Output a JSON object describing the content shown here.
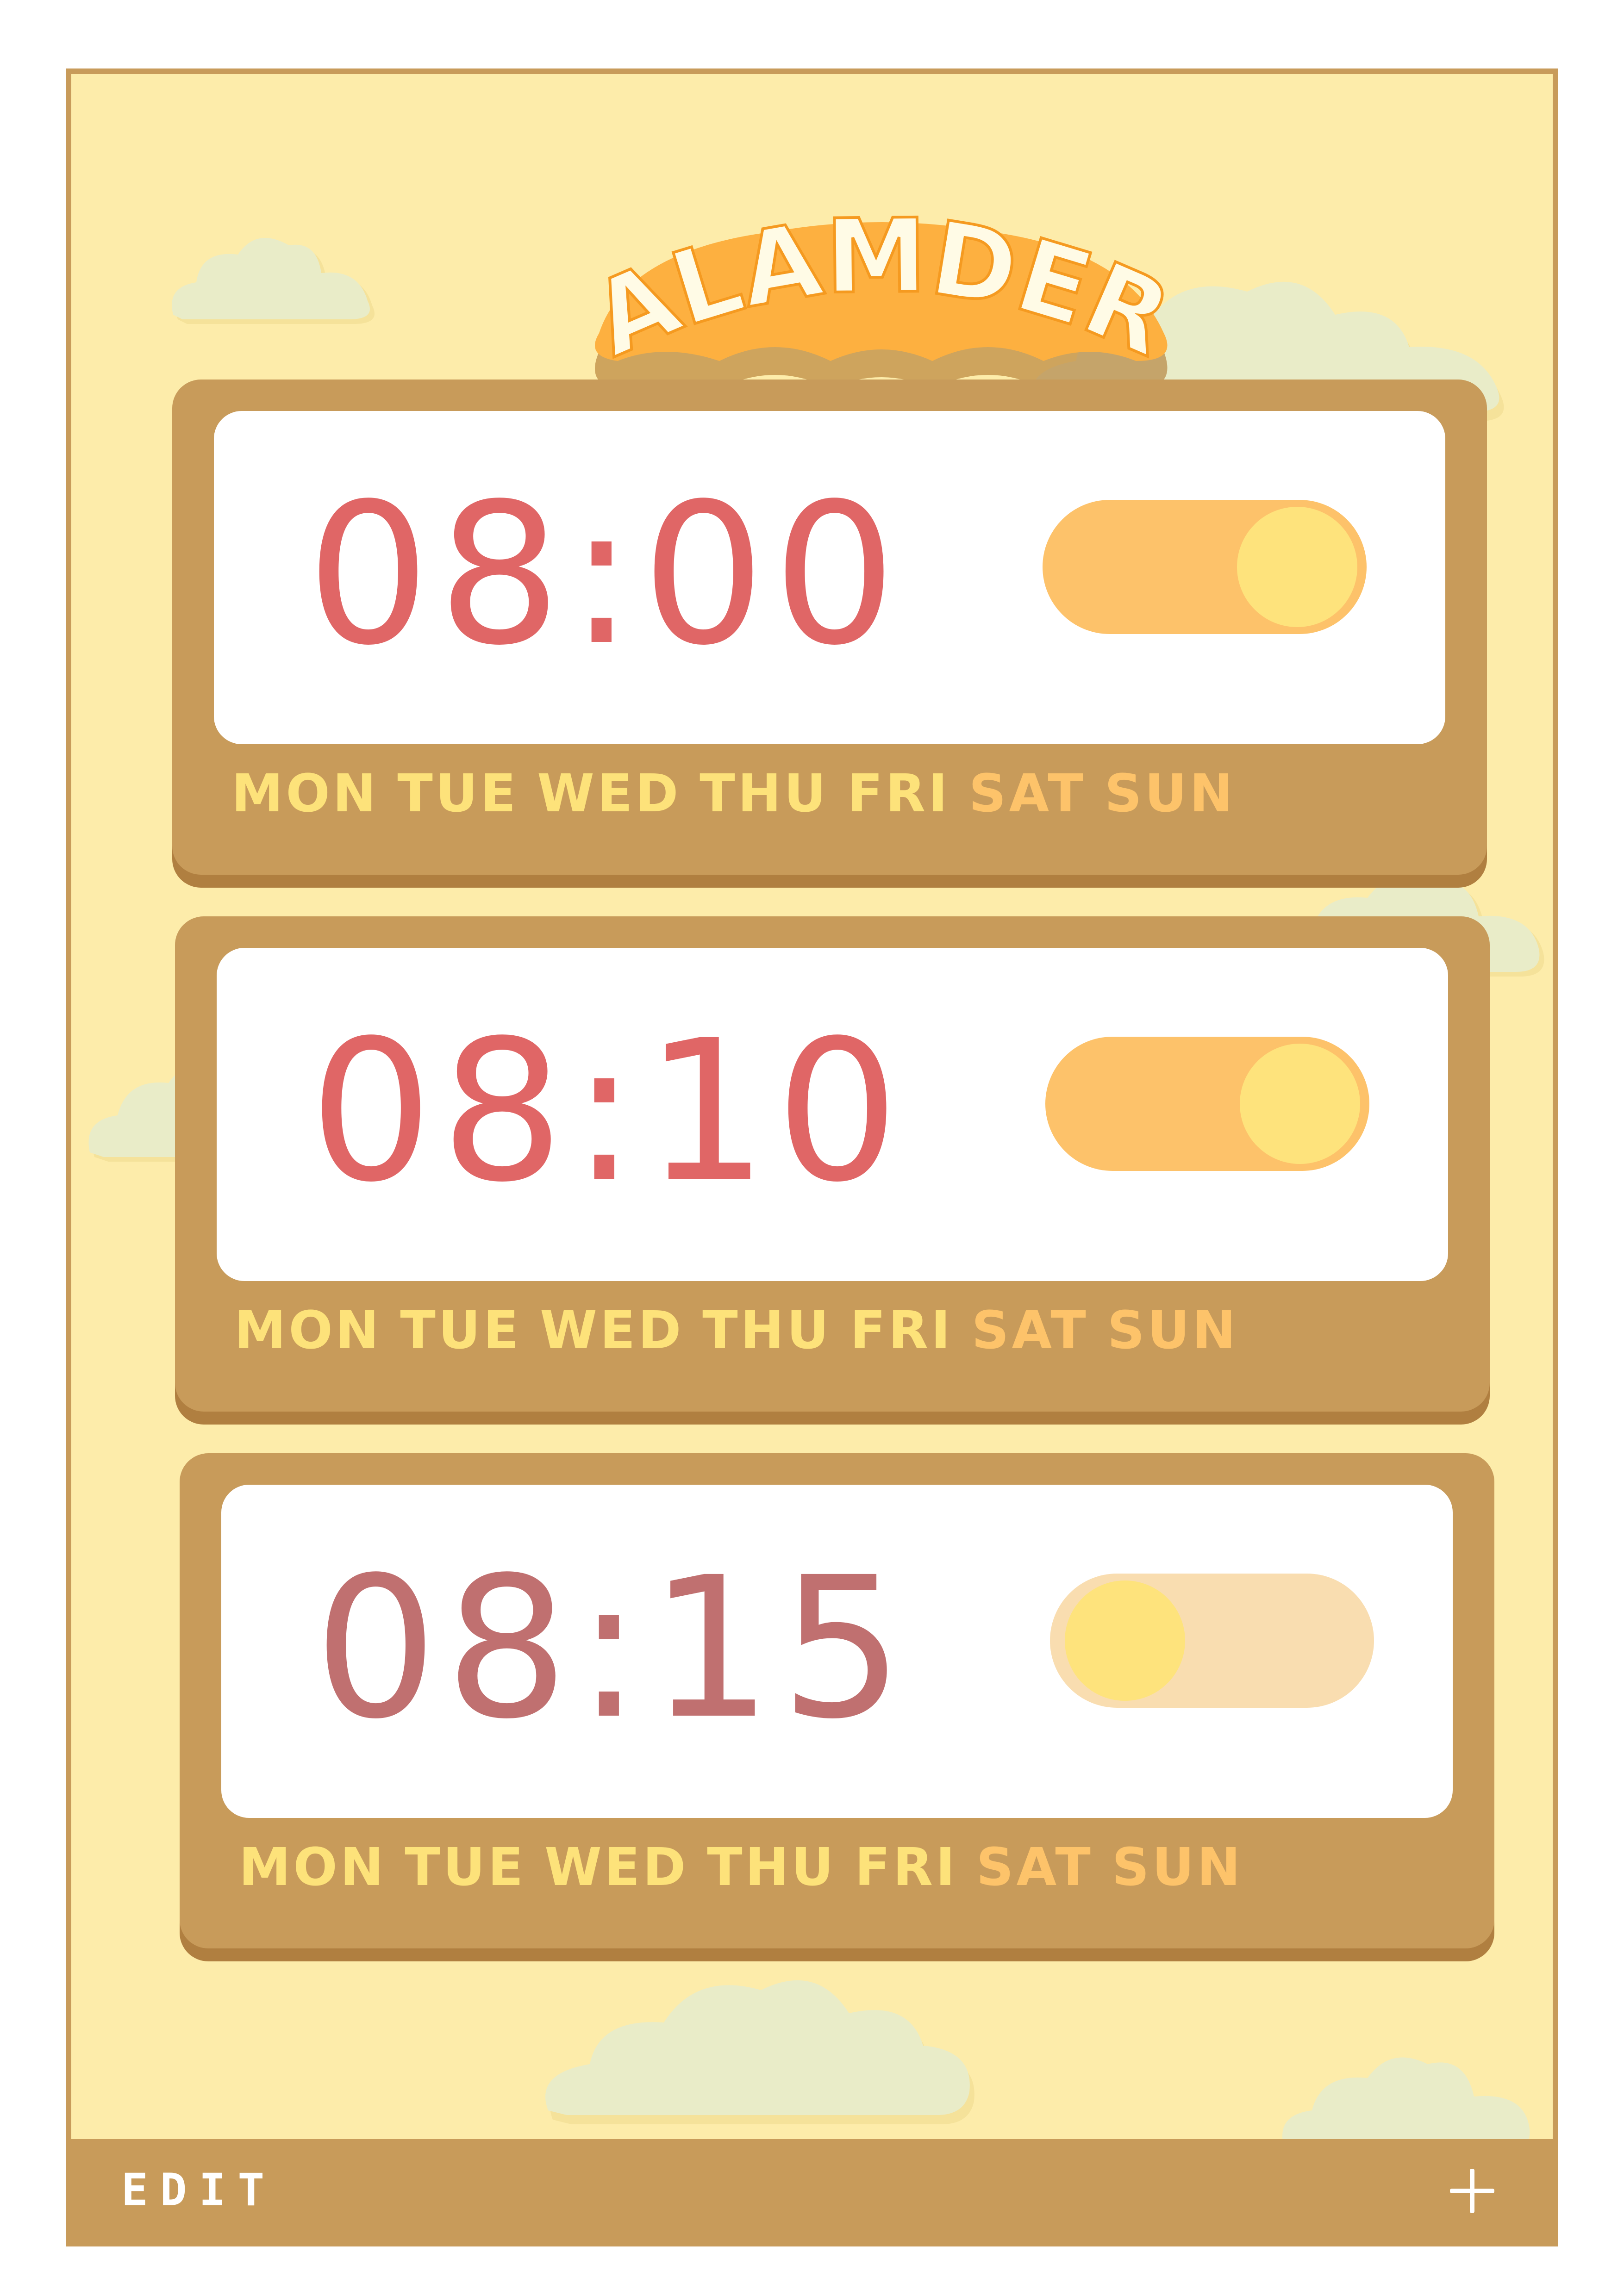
{
  "app": {
    "title": "ALAMDER"
  },
  "alarms": [
    {
      "time": "08:00",
      "enabled": true,
      "days": [
        {
          "label": "MON",
          "weekend": false
        },
        {
          "label": "TUE",
          "weekend": false
        },
        {
          "label": "WED",
          "weekend": false
        },
        {
          "label": "THU",
          "weekend": false
        },
        {
          "label": "FRI",
          "weekend": false
        },
        {
          "label": "SAT",
          "weekend": true
        },
        {
          "label": "SUN",
          "weekend": true
        }
      ]
    },
    {
      "time": "08:10",
      "enabled": true,
      "days": [
        {
          "label": "MON",
          "weekend": false
        },
        {
          "label": "TUE",
          "weekend": false
        },
        {
          "label": "WED",
          "weekend": false
        },
        {
          "label": "THU",
          "weekend": false
        },
        {
          "label": "FRI",
          "weekend": false
        },
        {
          "label": "SAT",
          "weekend": true
        },
        {
          "label": "SUN",
          "weekend": true
        }
      ]
    },
    {
      "time": "08:15",
      "enabled": false,
      "days": [
        {
          "label": "MON",
          "weekend": false
        },
        {
          "label": "TUE",
          "weekend": false
        },
        {
          "label": "WED",
          "weekend": false
        },
        {
          "label": "THU",
          "weekend": false
        },
        {
          "label": "FRI",
          "weekend": false
        },
        {
          "label": "SAT",
          "weekend": true
        },
        {
          "label": "SUN",
          "weekend": true
        }
      ]
    }
  ],
  "footer": {
    "edit_label": "EDIT",
    "add_icon": "plus-icon"
  },
  "colors": {
    "background": "#fdecaa",
    "frame": "#c89b5a",
    "time_active": "#e06666",
    "time_inactive": "#c07070",
    "toggle_on": "#fdc26a",
    "toggle_off": "#f9ddb0",
    "knob": "#fee37c",
    "weekday": "#fde27a",
    "weekend": "#fdc36a",
    "logo_fill": "#fdb040",
    "logo_text": "#fffbe6"
  }
}
